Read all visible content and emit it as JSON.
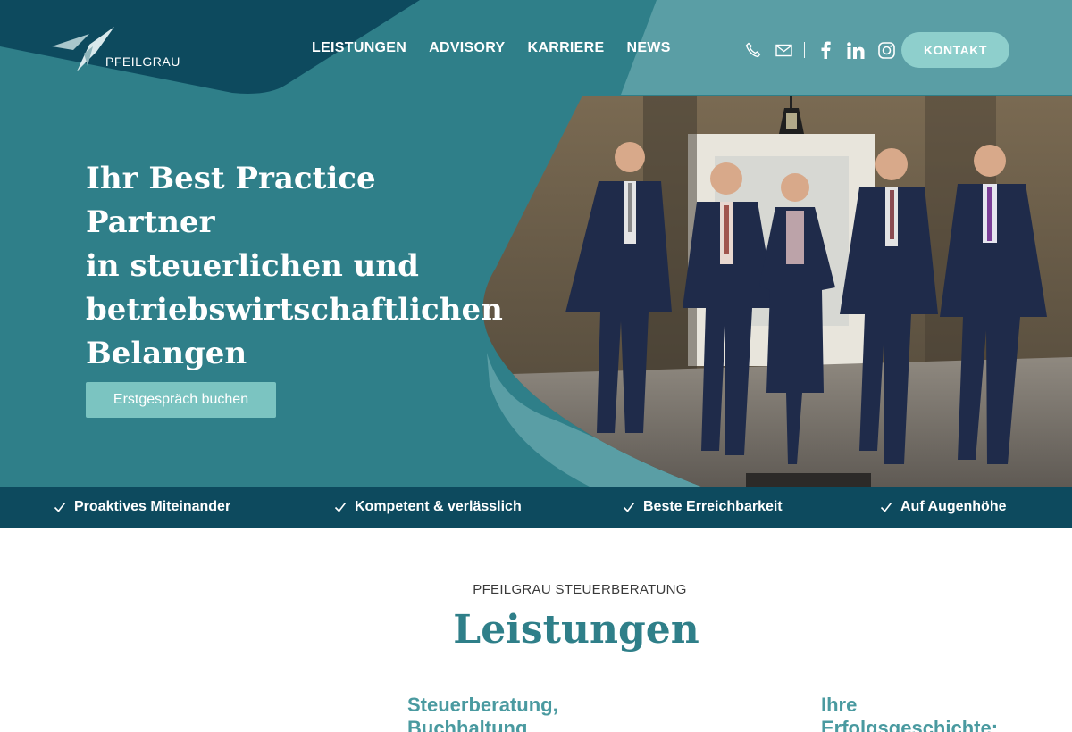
{
  "brand": {
    "name": "PFEILGRAU"
  },
  "nav": {
    "items": [
      "LEISTUNGEN",
      "ADVISORY",
      "KARRIERE",
      "NEWS"
    ],
    "icons": [
      "phone-icon",
      "mail-icon",
      "facebook-icon",
      "linkedin-icon",
      "instagram-icon"
    ],
    "contact_label": "KONTAKT"
  },
  "hero": {
    "headline": [
      "Ihr Best Practice Partner",
      "in steuerlichen und",
      "betriebswirtschaftlichen",
      "Belangen"
    ],
    "cta_label": "Erstgespräch buchen"
  },
  "usps": [
    "Proaktives Miteinander",
    "Kompetent & verlässlich",
    "Beste Erreichbarkeit",
    "Auf Augenhöhe"
  ],
  "services": {
    "eyebrow": "PFEILGRAU STEUERBERATUNG",
    "title": "Leistungen",
    "columns": [
      {
        "title_lines": [
          "Steuerberatung,",
          "Buchhaltung"
        ]
      },
      {
        "title_lines": [
          "Ihre",
          "Erfolgsgeschichte:"
        ]
      }
    ]
  },
  "colors": {
    "hero_teal": "#2f7f89",
    "dark_teal": "#0d4a5e",
    "light_teal": "#8ecfcc",
    "pale_teal": "#5a9ea5",
    "heading_teal": "#2f7f89",
    "white": "#ffffff"
  }
}
